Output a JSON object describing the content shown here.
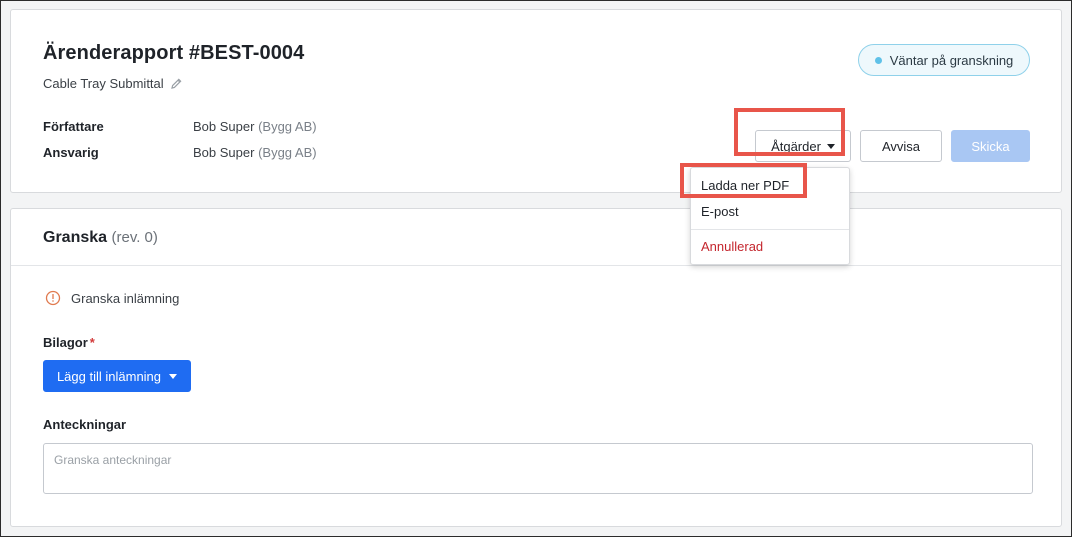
{
  "report": {
    "title": "Ärenderapport #BEST-0004",
    "subtitle": "Cable Tray Submittal",
    "status": "Väntar på granskning",
    "author_label": "Författare",
    "author_name": "Bob Super",
    "author_company": "(Bygg AB)",
    "assignee_label": "Ansvarig",
    "assignee_name": "Bob Super",
    "assignee_company": "(Bygg AB)"
  },
  "toolbar": {
    "actions_label": "Åtgärder",
    "reject_label": "Avvisa",
    "send_label": "Skicka"
  },
  "actions_menu": {
    "items": [
      "Ladda ner PDF",
      "E-post"
    ],
    "danger_item": "Annullerad"
  },
  "review": {
    "title": "Granska",
    "revision": "(rev. 0)",
    "notice": "Granska inlämning",
    "attachments_label": "Bilagor",
    "required_mark": "*",
    "add_button": "Lägg till inlämning",
    "notes_label": "Anteckningar",
    "notes_placeholder": "Granska anteckningar",
    "notes_value": ""
  },
  "colors": {
    "primary": "#1f6cf2",
    "disabled_primary": "#a9c7f3",
    "status_border": "#8fd1ea",
    "status_dot": "#5fc1e8",
    "danger": "#c4262e",
    "highlight": "#e8554a",
    "warning": "#e07a4f"
  },
  "icons": {
    "edit": "pencil-icon",
    "warning": "warning-circle-icon",
    "caret": "caret-down-icon"
  }
}
